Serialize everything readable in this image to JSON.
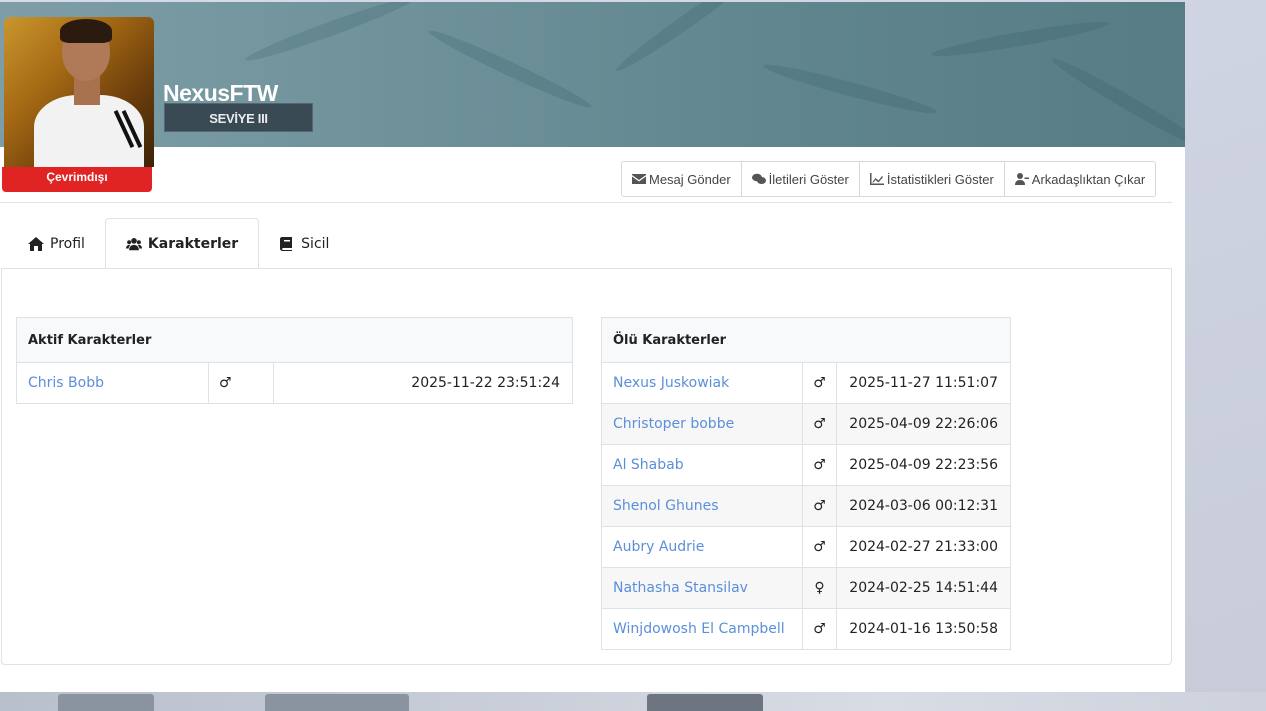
{
  "profile": {
    "username": "NexusFTW",
    "level": "SEVİYE III",
    "status": "Çevrimdışı"
  },
  "actions": [
    {
      "label": "Mesaj Gönder",
      "icon": "envelope-icon"
    },
    {
      "label": "İletileri Göster",
      "icon": "comments-icon"
    },
    {
      "label": "İstatistikleri Göster",
      "icon": "chart-icon"
    },
    {
      "label": "Arkadaşlıktan Çıkar",
      "icon": "user-minus-icon"
    }
  ],
  "tabs": [
    {
      "label": "Profil",
      "icon": "home-icon"
    },
    {
      "label": "Karakterler",
      "icon": "users-icon",
      "active": true
    },
    {
      "label": "Sicil",
      "icon": "book-icon"
    }
  ],
  "active_characters": {
    "title": "Aktif Karakterler",
    "rows": [
      {
        "name": "Chris Bobb",
        "gender": "♂",
        "date": "2025-11-22 23:51:24"
      }
    ]
  },
  "dead_characters": {
    "title": "Ölü Karakterler",
    "rows": [
      {
        "name": "Nexus Juskowiak",
        "gender": "♂",
        "date": "2025-11-27 11:51:07"
      },
      {
        "name": "Christoper bobbe",
        "gender": "♂",
        "date": "2025-04-09 22:26:06"
      },
      {
        "name": "Al Shabab",
        "gender": "♂",
        "date": "2025-04-09 22:23:56"
      },
      {
        "name": "Shenol Ghunes",
        "gender": "♂",
        "date": "2024-03-06 00:12:31"
      },
      {
        "name": "Aubry Audrie",
        "gender": "♂",
        "date": "2024-02-27 21:33:00"
      },
      {
        "name": "Nathasha Stansilav",
        "gender": "♀",
        "date": "2024-02-25 14:51:44"
      },
      {
        "name": "Winjdowosh El Campbell",
        "gender": "♂",
        "date": "2024-01-16 13:50:58"
      }
    ]
  },
  "colors": {
    "status_offline": "#e02424",
    "link": "#5b8fd9",
    "banner": "#6c8f98"
  }
}
